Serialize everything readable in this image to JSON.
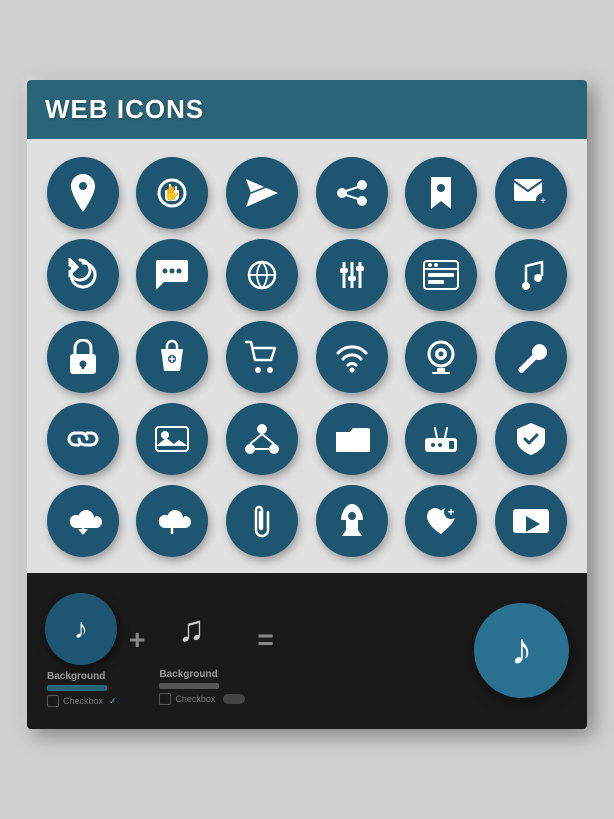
{
  "header": {
    "title": "WEB ICONS",
    "bg_color": "#2a6478"
  },
  "icons": [
    {
      "name": "location-pin-icon",
      "label": "location pin"
    },
    {
      "name": "stop-hand-icon",
      "label": "stop hand"
    },
    {
      "name": "paper-plane-icon",
      "label": "paper plane"
    },
    {
      "name": "share-dots-icon",
      "label": "share dots"
    },
    {
      "name": "bookmark-icon",
      "label": "bookmark"
    },
    {
      "name": "mail-add-icon",
      "label": "mail add"
    },
    {
      "name": "refresh-icon",
      "label": "refresh"
    },
    {
      "name": "chat-icon",
      "label": "chat"
    },
    {
      "name": "globe-icon",
      "label": "globe"
    },
    {
      "name": "sliders-icon",
      "label": "sliders"
    },
    {
      "name": "browser-icon",
      "label": "browser"
    },
    {
      "name": "music-note-icon",
      "label": "music note"
    },
    {
      "name": "lock-icon",
      "label": "lock"
    },
    {
      "name": "shopping-bag-icon",
      "label": "shopping bag"
    },
    {
      "name": "cart-icon",
      "label": "shopping cart"
    },
    {
      "name": "wifi-icon",
      "label": "wifi"
    },
    {
      "name": "webcam-icon",
      "label": "webcam"
    },
    {
      "name": "wrench-icon",
      "label": "wrench"
    },
    {
      "name": "link-icon",
      "label": "link"
    },
    {
      "name": "image-icon",
      "label": "image"
    },
    {
      "name": "network-icon",
      "label": "network"
    },
    {
      "name": "folder-icon",
      "label": "folder"
    },
    {
      "name": "router-icon",
      "label": "router"
    },
    {
      "name": "shield-icon",
      "label": "shield"
    },
    {
      "name": "cloud-download-icon",
      "label": "cloud download"
    },
    {
      "name": "cloud-upload-icon",
      "label": "cloud upload"
    },
    {
      "name": "paperclip-icon",
      "label": "paperclip"
    },
    {
      "name": "rocket-icon",
      "label": "rocket"
    },
    {
      "name": "heart-add-icon",
      "label": "heart add"
    },
    {
      "name": "video-player-icon",
      "label": "video player"
    }
  ],
  "bottom": {
    "left_label": "Background",
    "right_label": "Background",
    "checkbox_label": "Checkbox",
    "plus_operator": "+",
    "equals_operator": "="
  }
}
